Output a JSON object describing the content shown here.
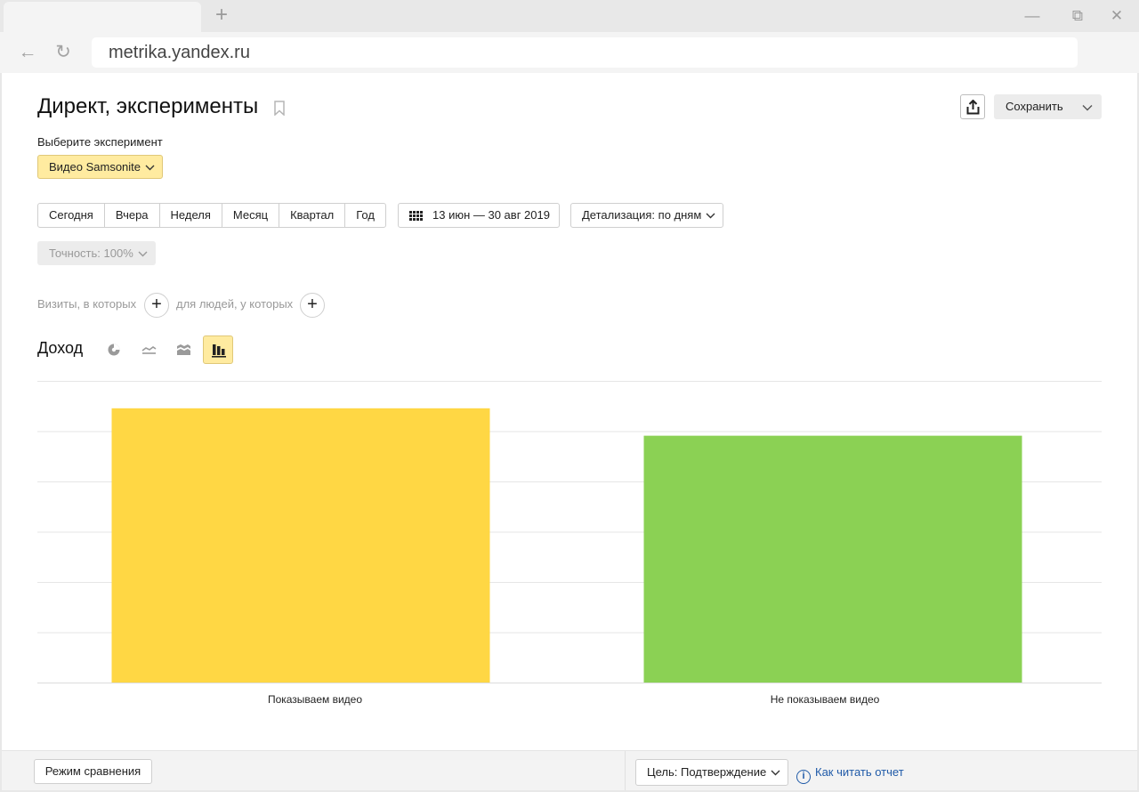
{
  "browser": {
    "new_tab_glyph": "+",
    "address": "metrika.yandex.ru",
    "window_controls": [
      "minimize",
      "restore",
      "close"
    ]
  },
  "report": {
    "title": "Директ, эксперименты",
    "save_label": "Сохранить",
    "experiment_label": "Выберите эксперимент",
    "experiment_value": "Видео Samsonite"
  },
  "periods": [
    "Сегодня",
    "Вчера",
    "Неделя",
    "Месяц",
    "Квартал",
    "Год"
  ],
  "date_range": "13 июн — 30 авг 2019",
  "detail_label": "Детализация: по дням",
  "accuracy_label": "Точность: 100%",
  "segments": {
    "visits_label": "Визиты, в которых",
    "people_label": "для людей, у которых"
  },
  "metric_label": "Доход",
  "chart_types": [
    "pie-chart",
    "line-chart",
    "area-chart",
    "bar-chart"
  ],
  "active_chart_type": "bar-chart",
  "chart_data": {
    "type": "bar",
    "categories": [
      "Показываем видео",
      "Не показываем видео"
    ],
    "values": [
      1.0,
      0.9
    ],
    "colors": [
      "#ffd744",
      "#8bd154"
    ],
    "ylim": [
      0,
      1.1
    ],
    "gridlines": 6,
    "grid": true,
    "title": "",
    "xlabel": "",
    "ylabel": ""
  },
  "footer": {
    "compare_label": "Режим сравнения",
    "goal_label": "Цель: Подтверждение",
    "howto_label": "Как читать отчет"
  },
  "colors": {
    "accent_yellow": "#ffeba0",
    "link": "#1f5aa8"
  }
}
